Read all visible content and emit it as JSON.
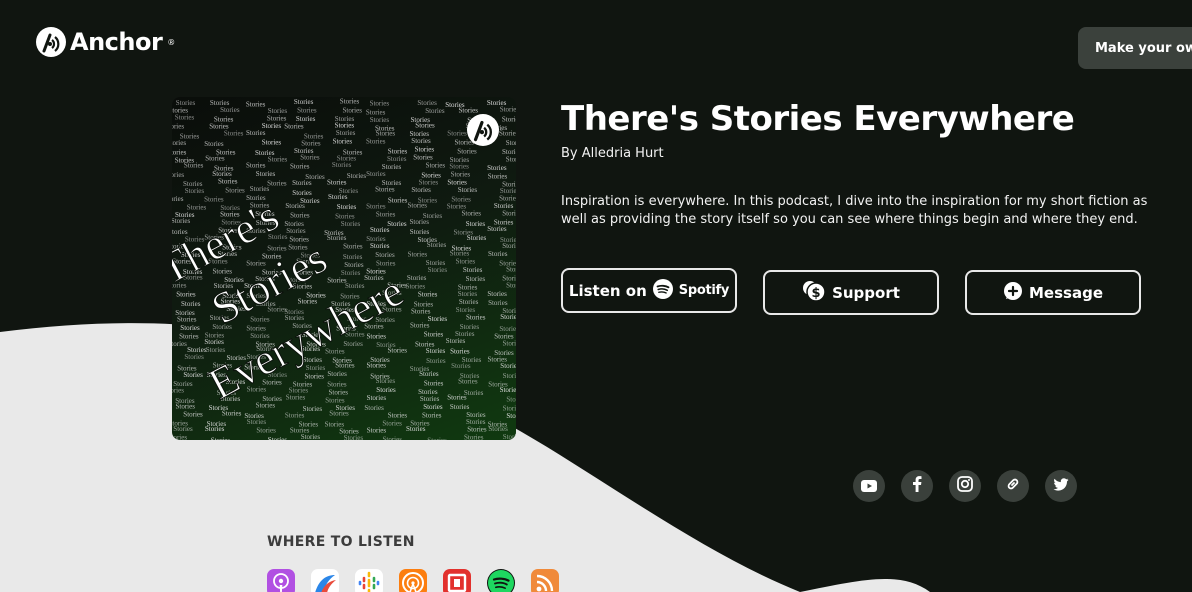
{
  "brand": {
    "name": "Anchor",
    "reg": "®"
  },
  "header": {
    "make_button_label": "Make your own"
  },
  "cover": {
    "title_lines": [
      "There's",
      "Stories",
      "Everywhere"
    ],
    "pattern_word": "Stories"
  },
  "podcast": {
    "title": "There's Stories Everywhere",
    "author": "By Alledria Hurt",
    "description": "Inspiration is everywhere. In this podcast, I dive into the inspiration for my short fiction as well as providing the story itself so you can see where things begin and where they end."
  },
  "actions": {
    "listen_label": "Listen on",
    "spotify_label": "Spotify",
    "support_label": "Support",
    "message_label": "Message"
  },
  "social": [
    "youtube-icon",
    "facebook-icon",
    "instagram-icon",
    "link-icon",
    "twitter-icon"
  ],
  "where_to_listen": {
    "title": "WHERE TO LISTEN",
    "platforms": [
      {
        "name": "apple-podcasts-icon",
        "color": "#b150e2"
      },
      {
        "name": "breaker-icon",
        "color": "#ffffff"
      },
      {
        "name": "google-podcasts-icon",
        "color": "#ffffff"
      },
      {
        "name": "overcast-icon",
        "color": "#fc7e0f"
      },
      {
        "name": "pocket-casts-icon",
        "color": "#e2312d"
      },
      {
        "name": "spotify-icon",
        "color": "#1ed760"
      },
      {
        "name": "rss-icon",
        "color": "#f08a3a"
      }
    ]
  },
  "colors": {
    "background": "#101510",
    "wave": "#e9e9e9",
    "social_bg": "#3a403b"
  }
}
